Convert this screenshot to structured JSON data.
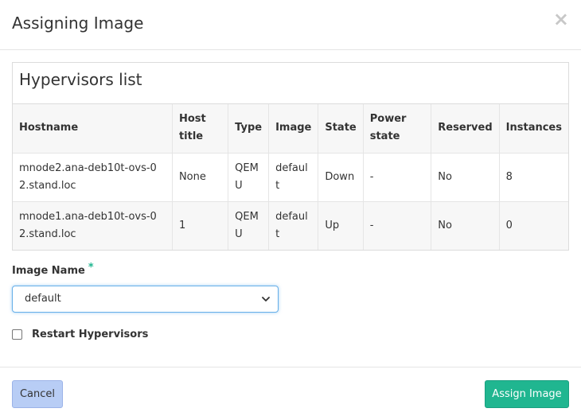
{
  "modal": {
    "title": "Assigning Image",
    "close_glyph": "×"
  },
  "panel": {
    "title": "Hypervisors list"
  },
  "table": {
    "headers": [
      "Hostname",
      "Host title",
      "Type",
      "Image",
      "State",
      "Power state",
      "Reserved",
      "Instances"
    ],
    "rows": [
      [
        "mnode2.ana-deb10t-ovs-02.stand.loc",
        "None",
        "QEMU",
        "default",
        "Down",
        "-",
        "No",
        "8"
      ],
      [
        "mnode1.ana-deb10t-ovs-02.stand.loc",
        "1",
        "QEMU",
        "default",
        "Up",
        "-",
        "No",
        "0"
      ]
    ]
  },
  "form": {
    "image_name_label": "Image Name",
    "required_mark": "*",
    "image_name_value": "default",
    "restart_label": "Restart Hypervisors",
    "restart_checked": false
  },
  "footer": {
    "cancel_label": "Cancel",
    "submit_label": "Assign Image"
  },
  "colors": {
    "primary": "#20b690",
    "cancel": "#b8cdf5",
    "focus_border": "#66afe9"
  },
  "icons": {
    "close": "close-icon",
    "select_arrow": "chevron-down-icon"
  }
}
